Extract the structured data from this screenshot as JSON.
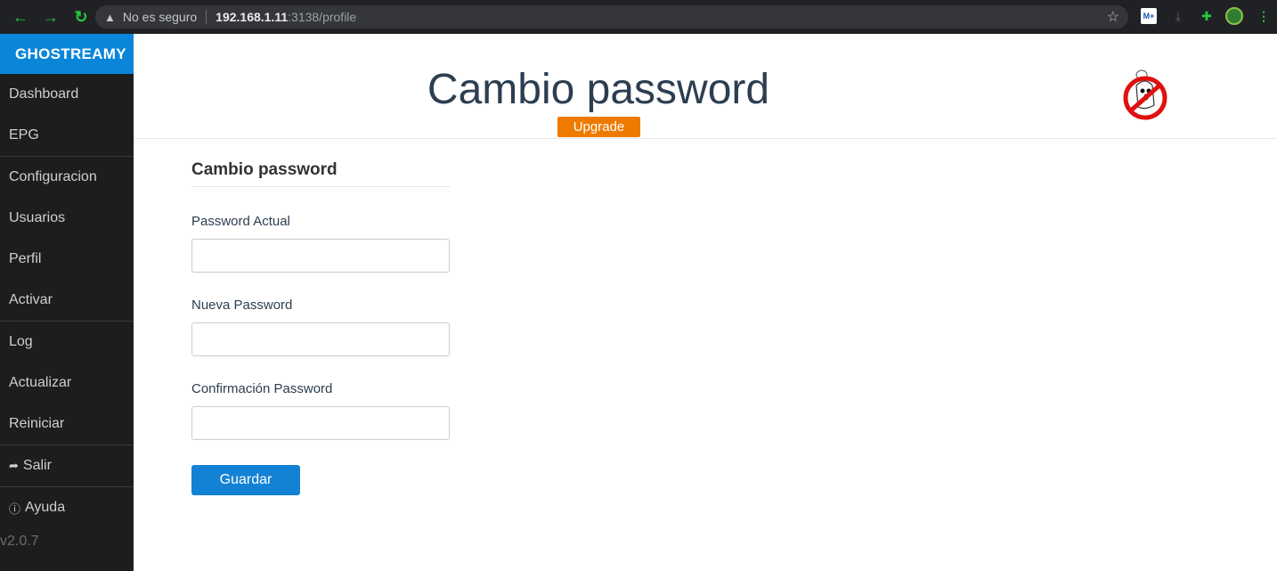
{
  "browser": {
    "security_label": "No es seguro",
    "url_host": "192.168.1.11",
    "url_rest": ":3138/profile",
    "extension_m_label": "M+"
  },
  "sidebar": {
    "brand": "GHOSTREAMY",
    "groups": [
      [
        {
          "label": "Dashboard"
        },
        {
          "label": "EPG"
        }
      ],
      [
        {
          "label": "Configuracion"
        },
        {
          "label": "Usuarios"
        },
        {
          "label": "Perfil"
        },
        {
          "label": "Activar"
        }
      ],
      [
        {
          "label": "Log"
        },
        {
          "label": "Actualizar"
        },
        {
          "label": "Reiniciar"
        }
      ],
      [
        {
          "label": "Salir",
          "icon": "sign-out-icon"
        }
      ],
      [
        {
          "label": "Ayuda",
          "icon": "info-circle-icon"
        }
      ]
    ],
    "version": "v2.0.7"
  },
  "header": {
    "title": "Cambio password",
    "upgrade_label": "Upgrade"
  },
  "form": {
    "title": "Cambio password",
    "current_password_label": "Password Actual",
    "current_password_value": "",
    "new_password_label": "Nueva Password",
    "new_password_value": "",
    "confirm_password_label": "Confirmación Password",
    "confirm_password_value": "",
    "save_label": "Guardar"
  },
  "colors": {
    "brand": "#0a86d9",
    "sidebar_bg": "#1d1d1d",
    "upgrade": "#ee7b00",
    "primary_button": "#1482d4",
    "title_text": "#2c3e50"
  }
}
